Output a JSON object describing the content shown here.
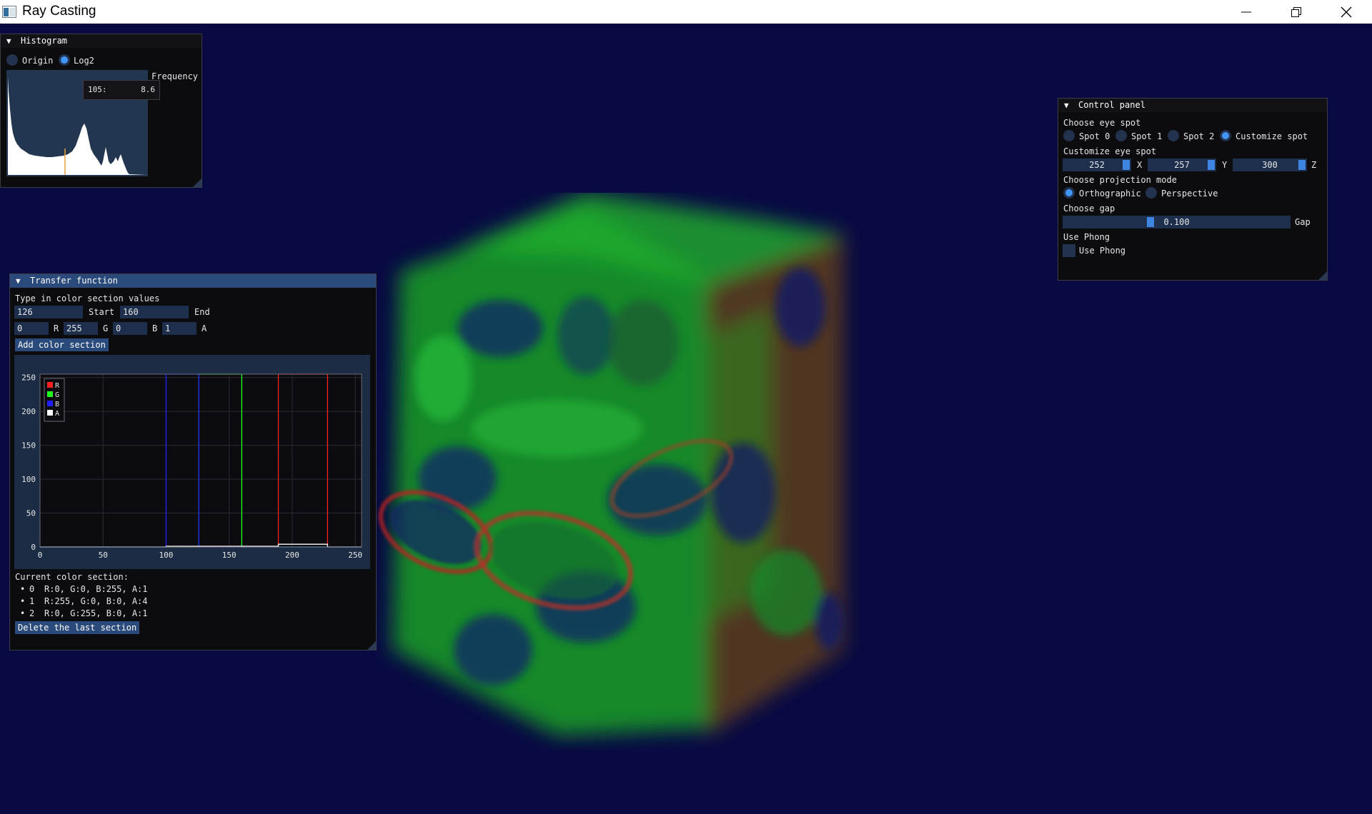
{
  "window": {
    "title": "Ray Casting",
    "buttons": [
      "minimize",
      "restore",
      "close"
    ]
  },
  "histogram": {
    "title": "Histogram",
    "modes": [
      {
        "label": "Origin",
        "selected": false
      },
      {
        "label": "Log2",
        "selected": true
      }
    ],
    "axis_label": "Frequency",
    "tooltip_key": "105:",
    "tooltip_value": "8.6"
  },
  "transfer": {
    "title": "Transfer function",
    "prompt": "Type in color section values",
    "start_value": "126",
    "start_label": "Start",
    "end_value": "160",
    "end_label": "End",
    "r_value": "0",
    "r_label": "R",
    "g_value": "255",
    "g_label": "G",
    "b_value": "0",
    "b_label": "B",
    "a_value": "1",
    "a_label": "A",
    "add_button": "Add color section",
    "current_label": "Current color section:",
    "sections": [
      {
        "index": "0",
        "text": "R:0, G:0, B:255, A:1"
      },
      {
        "index": "1",
        "text": "R:255, G:0, B:0, A:4"
      },
      {
        "index": "2",
        "text": "R:0, G:255, B:0, A:1"
      }
    ],
    "delete_button": "Delete the last section"
  },
  "chart_data": {
    "type": "line",
    "xlim": [
      0,
      255
    ],
    "ylim": [
      0,
      255
    ],
    "x_ticks": [
      "0",
      "50",
      "100",
      "150",
      "200",
      "250"
    ],
    "y_ticks": [
      "250",
      "200",
      "150",
      "100",
      "50",
      "0"
    ],
    "grid": true,
    "legend_position": "top-left",
    "series": [
      {
        "name": "R",
        "color": "#ff2020",
        "x": [
          0,
          189,
          189,
          228,
          228,
          255
        ],
        "y": [
          0,
          0,
          255,
          255,
          0,
          0
        ]
      },
      {
        "name": "G",
        "color": "#20ff20",
        "x": [
          0,
          126,
          126,
          160,
          160,
          255
        ],
        "y": [
          0,
          0,
          255,
          255,
          0,
          0
        ]
      },
      {
        "name": "B",
        "color": "#2020ff",
        "x": [
          0,
          100,
          100,
          126,
          126,
          255
        ],
        "y": [
          0,
          0,
          255,
          255,
          0,
          0
        ]
      },
      {
        "name": "A",
        "color": "#ffffff",
        "x": [
          0,
          100,
          100,
          189,
          189,
          228,
          228,
          255
        ],
        "y": [
          0,
          0,
          1,
          1,
          4,
          4,
          0,
          0
        ]
      }
    ]
  },
  "control": {
    "title": "Control panel",
    "eye_label": "Choose eye spot",
    "spots": [
      {
        "label": "Spot 0",
        "selected": false
      },
      {
        "label": "Spot 1",
        "selected": false
      },
      {
        "label": "Spot 2",
        "selected": false
      },
      {
        "label": "Customize spot",
        "selected": true
      }
    ],
    "custom_label": "Customize eye spot",
    "x_value": "252",
    "x_label": "X",
    "y_value": "257",
    "y_label": "Y",
    "z_value": "300",
    "z_label": "Z",
    "proj_label": "Choose projection mode",
    "projections": [
      {
        "label": "Orthographic",
        "selected": true
      },
      {
        "label": "Perspective",
        "selected": false
      }
    ],
    "gap_label": "Choose gap",
    "gap_value": "0.100",
    "gap_fraction": 0.38,
    "gap_suffix": "Gap",
    "phong_label": "Use Phong",
    "phong_checkbox_label": "Use Phong",
    "phong_checked": false
  },
  "colors": {
    "background": "#090a44",
    "accent": "#4296fa",
    "frame": "#1d2f4d",
    "title_active": "#294a7a"
  }
}
